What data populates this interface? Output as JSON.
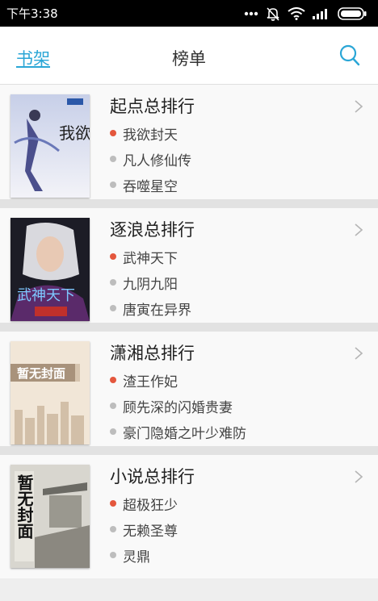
{
  "status_bar": {
    "time": "下午3:38"
  },
  "header": {
    "back_label": "书架",
    "title": "榜单"
  },
  "rankings": [
    {
      "title": "起点总排行",
      "cover_text": "我欲封天",
      "books": [
        "我欲封天",
        "凡人修仙传",
        "吞噬星空"
      ]
    },
    {
      "title": "逐浪总排行",
      "cover_text": "武神天下",
      "books": [
        "武神天下",
        "九阴九阳",
        "唐寅在异界"
      ]
    },
    {
      "title": "潇湘总排行",
      "cover_text": "暂无封面",
      "books": [
        "渣王作妃",
        "顾先深的闪婚贵妻",
        "豪门隐婚之叶少难防"
      ]
    },
    {
      "title": "小说总排行",
      "cover_text": "暂无封面",
      "books": [
        "超极狂少",
        "无赖圣尊",
        "灵鼎"
      ]
    }
  ],
  "colors": {
    "accent": "#2aa6d6",
    "hot_dot": "#e4573d",
    "dot": "#bdbdbd"
  },
  "icons": [
    "signal-dots-icon",
    "mute-icon",
    "wifi-icon",
    "signal-bars-icon",
    "battery-icon",
    "search-icon",
    "chevron-right-icon"
  ]
}
